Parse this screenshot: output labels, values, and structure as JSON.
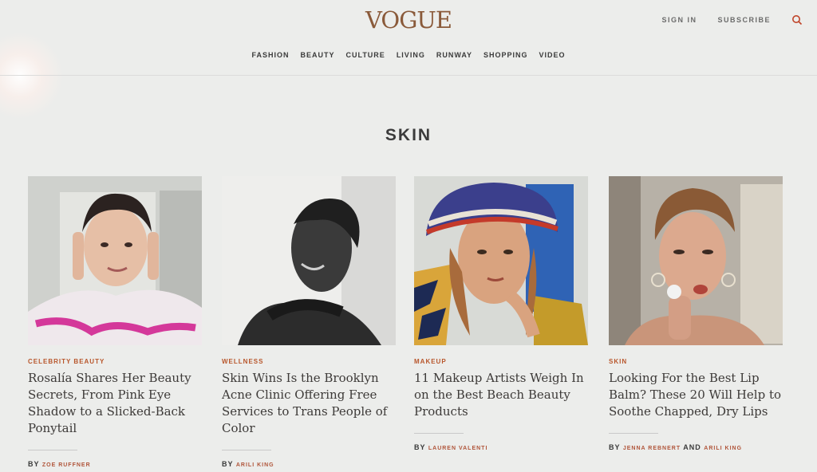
{
  "header": {
    "logo": "VOGUE",
    "sign_in": "SIGN IN",
    "subscribe": "SUBSCRIBE",
    "search_icon": "search-icon"
  },
  "nav": [
    "FASHION",
    "BEAUTY",
    "CULTURE",
    "LIVING",
    "RUNWAY",
    "SHOPPING",
    "VIDEO"
  ],
  "section_title": "SKIN",
  "cards": [
    {
      "kicker": "CELEBRITY BEAUTY",
      "headline": "Rosalía Shares Her Beauty Secrets, From Pink Eye Shadow to a Slicked-Back Ponytail",
      "by": "BY",
      "author": "ZOE RUFFNER"
    },
    {
      "kicker": "WELLNESS",
      "headline": "Skin Wins Is the Brooklyn Acne Clinic Offering Free Services to Trans People of Color",
      "by": "BY",
      "author": "ARILI KING"
    },
    {
      "kicker": "MAKEUP",
      "headline": "11 Makeup Artists Weigh In on the Best Beach Beauty Products",
      "by": "BY",
      "author": "LAUREN VALENTI"
    },
    {
      "kicker": "SKIN",
      "headline": "Looking For the Best Lip Balm? These 20 Will Help to Soothe Chapped, Dry Lips",
      "by": "BY",
      "author": "JENNA REBNERT",
      "and": "AND",
      "author2": "ARILI KING"
    }
  ],
  "colors": {
    "accent": "#b8562b",
    "background": "#ecedeb",
    "logo": "#8a5a3a"
  }
}
